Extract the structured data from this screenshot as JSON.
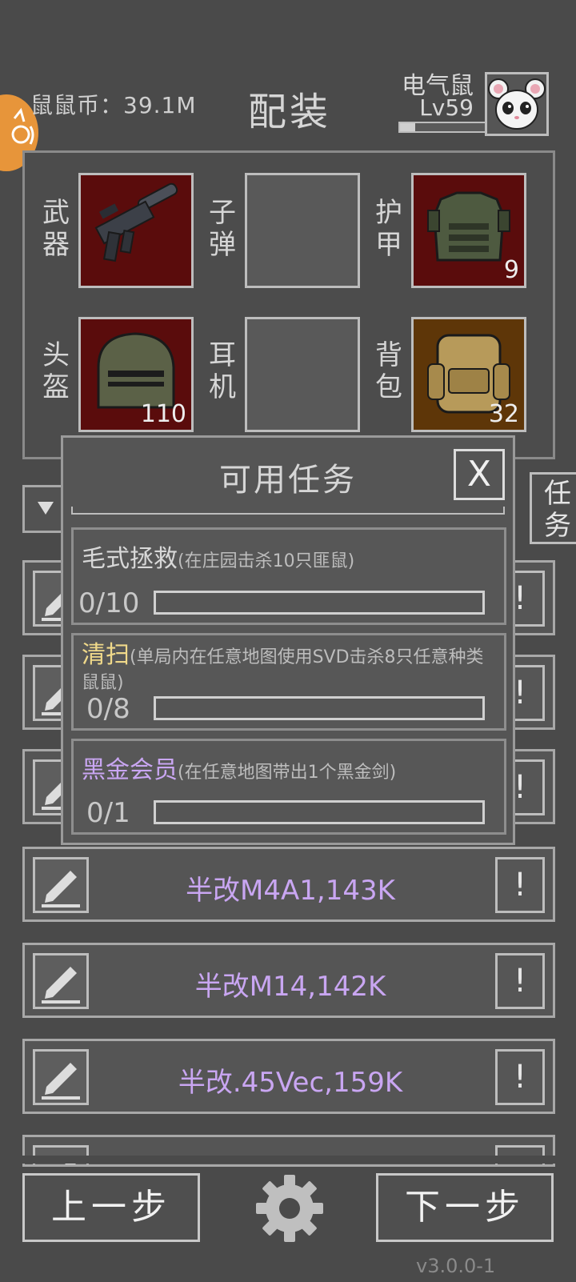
{
  "header": {
    "coin_label": "鼠鼠币：39.1M",
    "title": "配装",
    "player_name": "电气鼠",
    "player_level": "Lv59",
    "xp_progress": 0.18
  },
  "equipment": {
    "weapon_label": "武器",
    "ammo_label": "子弹",
    "armor_label": "护甲",
    "armor_count": "9",
    "helmet_label": "头盔",
    "helmet_count": "110",
    "earphone_label": "耳机",
    "backpack_label": "背包",
    "backpack_count": "32"
  },
  "quest_tab_label": "任务",
  "modal": {
    "title": "可用任务",
    "close_label": "X",
    "tasks": [
      {
        "name": "毛式拯救",
        "desc": "(在庄园击杀10只匪鼠)",
        "progress": "0/10",
        "ratio": 0,
        "name_color": "#d8d8d8"
      },
      {
        "name": "清扫",
        "desc": "(单局内在任意地图使用SVD击杀8只任意种类鼠鼠)",
        "progress": "0/8",
        "ratio": 0,
        "name_color": "#f0d98a"
      },
      {
        "name": "黑金会员",
        "desc": "(在任意地图带出1个黑金剑)",
        "progress": "0/1",
        "ratio": 0,
        "name_color": "#c9a6f2"
      }
    ]
  },
  "builds": [
    {
      "label": "",
      "info": "!"
    },
    {
      "label": "",
      "info": "!"
    },
    {
      "label": "",
      "info": "!"
    },
    {
      "label": "半改M4A1,143K",
      "info": "!"
    },
    {
      "label": "半改M14,142K",
      "info": "!"
    },
    {
      "label": "半改.45Vec,159K",
      "info": "!"
    },
    {
      "label": "",
      "info": ""
    }
  ],
  "footer": {
    "prev_label": "上一步",
    "next_label": "下一步",
    "version": "v3.0.0-1"
  }
}
